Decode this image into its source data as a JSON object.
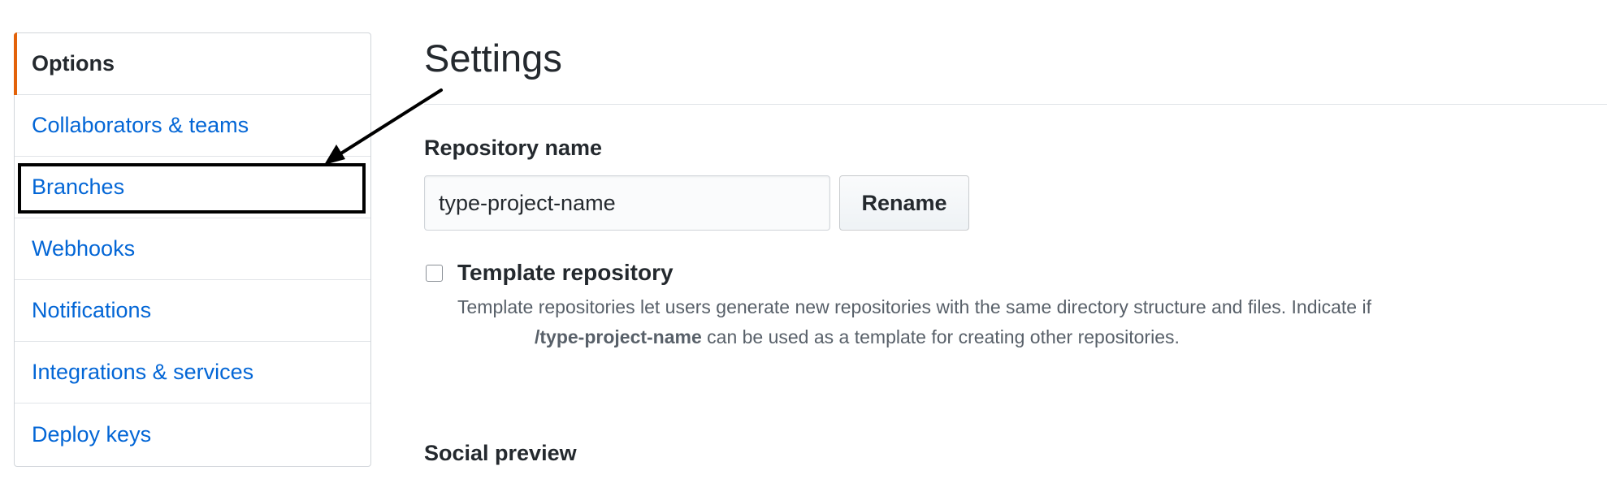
{
  "sidebar": {
    "items": [
      {
        "label": "Options"
      },
      {
        "label": "Collaborators & teams"
      },
      {
        "label": "Branches"
      },
      {
        "label": "Webhooks"
      },
      {
        "label": "Notifications"
      },
      {
        "label": "Integrations & services"
      },
      {
        "label": "Deploy keys"
      }
    ]
  },
  "main": {
    "title": "Settings",
    "repository_name_label": "Repository name",
    "repository_name_value": "type-project-name",
    "rename_button": "Rename",
    "template": {
      "label": "Template repository",
      "checked": false,
      "description_line1": "Template repositories let users generate new repositories with the same directory structure and files. Indicate if",
      "repo_name": "/type-project-name",
      "description_line2": "can be used as a template for creating other repositories."
    },
    "social_preview_label": "Social preview"
  },
  "colors": {
    "link": "#0366d6",
    "selected_accent": "#e36209",
    "annotation": "#000000"
  }
}
